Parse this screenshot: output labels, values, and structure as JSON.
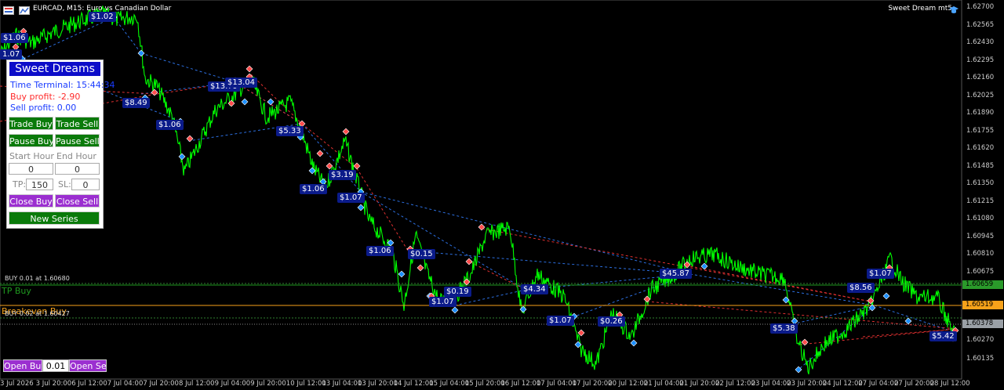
{
  "header": {
    "title": "EURCAD, M15:  Euro vs Canadian Dollar",
    "ea_name": "Sweet Dream mt5"
  },
  "price_axis": {
    "labels": [
      "1.62700",
      "1.62565",
      "1.62430",
      "1.62295",
      "1.62160",
      "1.62025",
      "1.61890",
      "1.61755",
      "1.61620",
      "1.61485",
      "1.61350",
      "1.61215",
      "1.61080",
      "1.60945",
      "1.60810",
      "1.60675"
    ],
    "tags": [
      {
        "text": "1.60659",
        "color": "#2a9a2a"
      },
      {
        "text": "1.60519",
        "color": "#f7a21a"
      },
      {
        "text": "1.60378",
        "color": "#9aa0a6"
      }
    ],
    "bottom_labels": [
      "1.60270",
      "1.60135"
    ]
  },
  "time_axis": [
    "3 Jul 2026",
    "3 Jul 20:00",
    "6 Jul 12:00",
    "7 Jul 04:00",
    "7 Jul 20:00",
    "8 Jul 12:00",
    "9 Jul 04:00",
    "9 Jul 20:00",
    "10 Jul 12:00",
    "13 Jul 04:00",
    "13 Jul 20:00",
    "14 Jul 12:00",
    "15 Jul 04:00",
    "15 Jul 20:00",
    "16 Jul 12:00",
    "17 Jul 04:00",
    "17 Jul 20:00",
    "20 Jul 12:00",
    "21 Jul 04:00",
    "21 Jul 20:00",
    "22 Jul 12:00",
    "23 Jul 04:00",
    "23 Jul 20:00",
    "24 Jul 12:00",
    "27 Jul 04:00",
    "27 Jul 20:00",
    "28 Jul 12:00"
  ],
  "lines": {
    "buy_line": "BUY 0.01 at 1.60680",
    "tp_buy": "TP Buy",
    "breakeven_buy": "Breakeven Buy",
    "buy_line2": "BUY 0.02 at 1.60427"
  },
  "profit_tags": [
    "$1.06",
    "$1.02",
    "1.07",
    "$8.49",
    "$13.79",
    "$13.04",
    "$1.06",
    "$5.33",
    "$1.06",
    "$3.19",
    "$1.07",
    "$1.06",
    "$0.15",
    "$1.07",
    "$0.19",
    "$4.34",
    "$1.07",
    "$0.26",
    "$45.87",
    "$5.38",
    "$8.56",
    "$1.07",
    "$5.42"
  ],
  "panel": {
    "title": "Sweet Dreams",
    "time_terminal": "Time Terminal: 15:44:34",
    "buy_profit": "Buy profit: -2.90",
    "sell_profit": "Sell profit: 0.00",
    "trade_buy": "Trade Buy",
    "trade_sell": "Trade Sell",
    "pause_buy": "Pause Buy",
    "pause_sell": "Pause Sell",
    "start_hour_label": "Start Hour",
    "end_hour_label": "End Hour",
    "start_hour": "0",
    "end_hour": "0",
    "tp_label": "TP:",
    "tp_value": "150",
    "sl_label": "SL:",
    "sl_value": "0",
    "close_buy": "Close Buy",
    "close_sell": "Close Sell",
    "new_series": "New Series"
  },
  "bottom_bar": {
    "open_buy": "Open Buy",
    "lot": "0.01",
    "open_sell": "Open Sell"
  },
  "colors": {
    "price_line": "#00ff00",
    "buy_arrow": "#1e90ff",
    "sell_arrow": "#ff4d4d",
    "tp_line": "#1f9a1f",
    "breakeven_line": "#f7a21a",
    "grid_dash": "#2f6f2f"
  }
}
